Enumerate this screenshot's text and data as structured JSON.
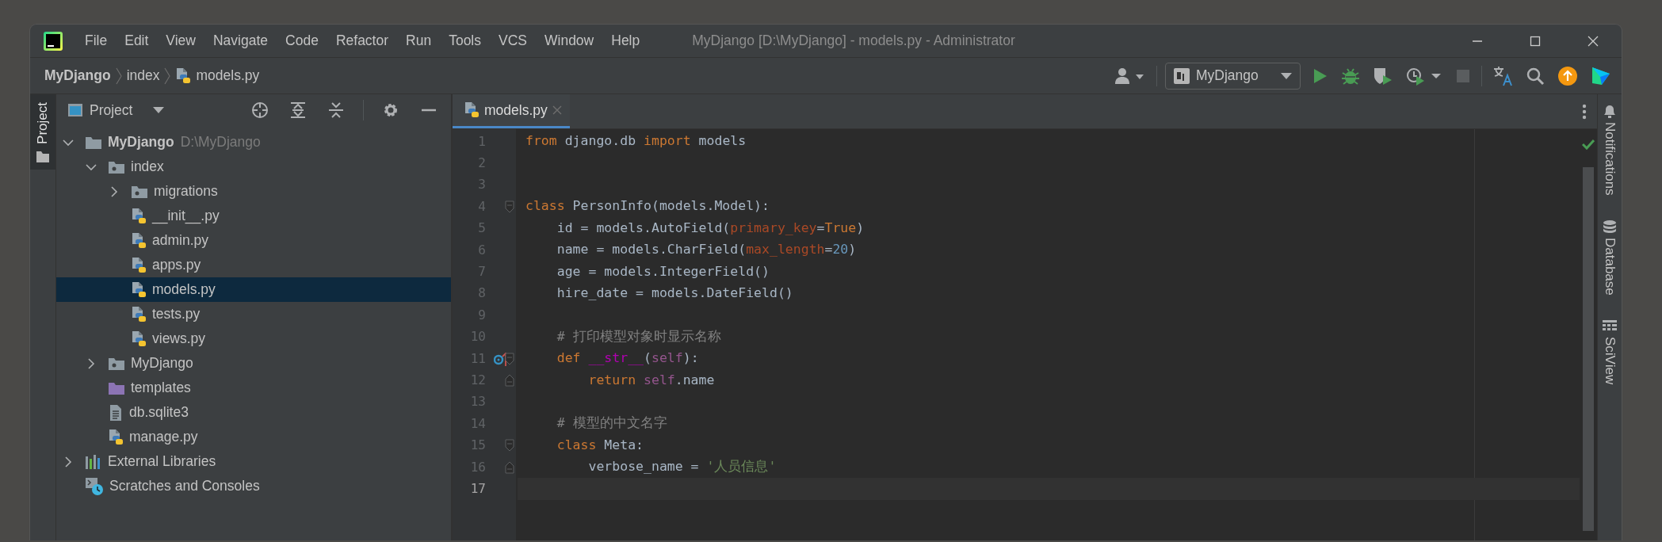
{
  "window": {
    "title": "MyDjango [D:\\MyDjango] - models.py - Administrator"
  },
  "menu": [
    "File",
    "Edit",
    "View",
    "Navigate",
    "Code",
    "Refactor",
    "Run",
    "Tools",
    "VCS",
    "Window",
    "Help"
  ],
  "breadcrumb": [
    {
      "label": "MyDjango",
      "kind": "project"
    },
    {
      "label": "index",
      "kind": "folder"
    },
    {
      "label": "models.py",
      "kind": "python"
    }
  ],
  "run_config": {
    "label": "MyDjango"
  },
  "left_stripe": [
    {
      "label": "Project",
      "selected": true
    }
  ],
  "project_panel": {
    "title": "Project",
    "tree": [
      {
        "label": "MyDjango",
        "hint": "D:\\MyDjango",
        "bold": true,
        "kind": "folder",
        "expanded": true,
        "selected": false,
        "children": [
          {
            "label": "index",
            "kind": "package",
            "expanded": true,
            "selected": false,
            "children": [
              {
                "label": "migrations",
                "kind": "package",
                "expanded": false,
                "selected": false
              },
              {
                "label": "__init__.py",
                "kind": "python",
                "selected": false
              },
              {
                "label": "admin.py",
                "kind": "python",
                "selected": false
              },
              {
                "label": "apps.py",
                "kind": "python",
                "selected": false
              },
              {
                "label": "models.py",
                "kind": "python",
                "selected": true
              },
              {
                "label": "tests.py",
                "kind": "python",
                "selected": false
              },
              {
                "label": "views.py",
                "kind": "python",
                "selected": false
              }
            ]
          },
          {
            "label": "MyDjango",
            "kind": "package",
            "expanded": false,
            "selected": false
          },
          {
            "label": "templates",
            "kind": "templates",
            "selected": false
          },
          {
            "label": "db.sqlite3",
            "kind": "text",
            "selected": false
          },
          {
            "label": "manage.py",
            "kind": "python",
            "selected": false
          }
        ]
      },
      {
        "label": "External Libraries",
        "kind": "libraries",
        "expanded": false,
        "selected": false
      },
      {
        "label": "Scratches and Consoles",
        "kind": "scratches",
        "selected": false
      }
    ]
  },
  "editor": {
    "tabs": [
      {
        "label": "models.py",
        "selected": true
      }
    ],
    "lines": [
      {
        "number": "1",
        "current": false,
        "kind": "plain",
        "tokens": [
          {
            "text": "from",
            "kind": "keyword"
          },
          {
            "text": " django.db ",
            "kind": "plain"
          },
          {
            "text": "import",
            "kind": "keyword"
          },
          {
            "text": " models",
            "kind": "plain"
          }
        ]
      },
      {
        "number": "2",
        "current": false,
        "kind": "plain"
      },
      {
        "number": "3",
        "current": false,
        "kind": "plain"
      },
      {
        "number": "4",
        "current": false,
        "kind": "fold-start",
        "tokens": [
          {
            "text": "class",
            "kind": "keyword"
          },
          {
            "text": " PersonInfo(models.Model):",
            "kind": "plain"
          }
        ]
      },
      {
        "number": "5",
        "current": false,
        "kind": "plain",
        "tokens": [
          {
            "text": "    id = models.AutoField(",
            "kind": "plain"
          },
          {
            "text": "primary_key",
            "kind": "param"
          },
          {
            "text": "=",
            "kind": "plain"
          },
          {
            "text": "True",
            "kind": "keyword"
          },
          {
            "text": ")",
            "kind": "plain"
          }
        ]
      },
      {
        "number": "6",
        "current": false,
        "kind": "plain",
        "tokens": [
          {
            "text": "    name = models.CharField(",
            "kind": "plain"
          },
          {
            "text": "max_length",
            "kind": "param"
          },
          {
            "text": "=",
            "kind": "plain"
          },
          {
            "text": "20",
            "kind": "number"
          },
          {
            "text": ")",
            "kind": "plain"
          }
        ]
      },
      {
        "number": "7",
        "current": false,
        "kind": "plain",
        "tokens": [
          {
            "text": "    age = models.IntegerField()",
            "kind": "plain"
          }
        ]
      },
      {
        "number": "8",
        "current": false,
        "kind": "plain",
        "tokens": [
          {
            "text": "    hire_date = models.DateField()",
            "kind": "plain"
          }
        ]
      },
      {
        "number": "9",
        "current": false,
        "kind": "plain"
      },
      {
        "number": "10",
        "current": false,
        "kind": "plain",
        "tokens": [
          {
            "text": "    # 打印模型对象时显示名称",
            "kind": "comment"
          }
        ]
      },
      {
        "number": "11",
        "current": false,
        "kind": "override-fold-start",
        "tokens": [
          {
            "text": "    def",
            "kind": "keyword"
          },
          {
            "text": " __str__",
            "kind": "magic"
          },
          {
            "text": "(",
            "kind": "plain"
          },
          {
            "text": "self",
            "kind": "self"
          },
          {
            "text": "):",
            "kind": "plain"
          }
        ]
      },
      {
        "number": "12",
        "current": false,
        "kind": "fold-end",
        "tokens": [
          {
            "text": "        return",
            "kind": "keyword"
          },
          {
            "text": " self",
            "kind": "self"
          },
          {
            "text": ".name",
            "kind": "plain"
          }
        ]
      },
      {
        "number": "13",
        "current": false,
        "kind": "plain"
      },
      {
        "number": "14",
        "current": false,
        "kind": "plain",
        "tokens": [
          {
            "text": "    # 模型的中文名字",
            "kind": "comment"
          }
        ]
      },
      {
        "number": "15",
        "current": false,
        "kind": "fold-start",
        "tokens": [
          {
            "text": "    class",
            "kind": "keyword"
          },
          {
            "text": " Meta:",
            "kind": "plain"
          }
        ]
      },
      {
        "number": "16",
        "current": false,
        "kind": "fold-end",
        "tokens": [
          {
            "text": "        verbose_name = ",
            "kind": "plain"
          },
          {
            "text": "'人员信息'",
            "kind": "string"
          }
        ]
      },
      {
        "number": "17",
        "current": true,
        "kind": "plain"
      }
    ]
  },
  "right_stripe": [
    {
      "label": "Notifications",
      "kind": "bell"
    },
    {
      "label": "Database",
      "kind": "database"
    },
    {
      "label": "SciView",
      "kind": "grid"
    }
  ]
}
